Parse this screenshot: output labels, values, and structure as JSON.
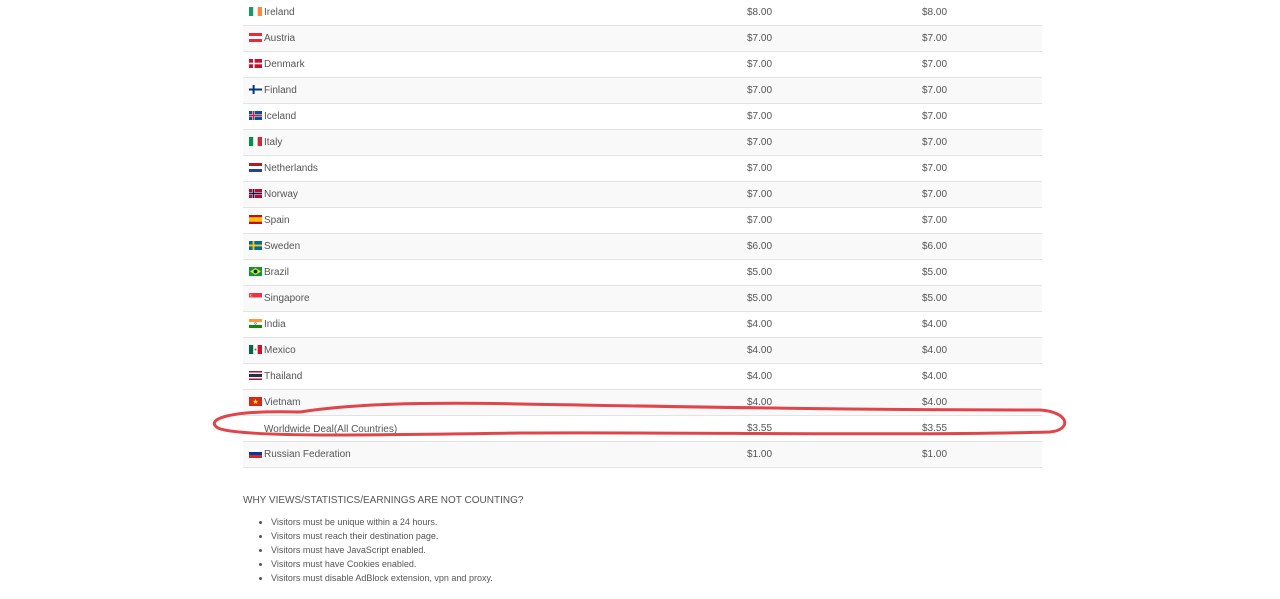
{
  "rates": [
    {
      "country": "Ireland",
      "flag": "ireland-flag-icon",
      "rate_a": "$8.00",
      "rate_b": "$8.00"
    },
    {
      "country": "Austria",
      "flag": "austria-flag-icon",
      "rate_a": "$7.00",
      "rate_b": "$7.00"
    },
    {
      "country": "Denmark",
      "flag": "denmark-flag-icon",
      "rate_a": "$7.00",
      "rate_b": "$7.00"
    },
    {
      "country": "Finland",
      "flag": "finland-flag-icon",
      "rate_a": "$7.00",
      "rate_b": "$7.00"
    },
    {
      "country": "Iceland",
      "flag": "iceland-flag-icon",
      "rate_a": "$7.00",
      "rate_b": "$7.00"
    },
    {
      "country": "Italy",
      "flag": "italy-flag-icon",
      "rate_a": "$7.00",
      "rate_b": "$7.00"
    },
    {
      "country": "Netherlands",
      "flag": "netherlands-flag-icon",
      "rate_a": "$7.00",
      "rate_b": "$7.00"
    },
    {
      "country": "Norway",
      "flag": "norway-flag-icon",
      "rate_a": "$7.00",
      "rate_b": "$7.00"
    },
    {
      "country": "Spain",
      "flag": "spain-flag-icon",
      "rate_a": "$7.00",
      "rate_b": "$7.00"
    },
    {
      "country": "Sweden",
      "flag": "sweden-flag-icon",
      "rate_a": "$6.00",
      "rate_b": "$6.00"
    },
    {
      "country": "Brazil",
      "flag": "brazil-flag-icon",
      "rate_a": "$5.00",
      "rate_b": "$5.00"
    },
    {
      "country": "Singapore",
      "flag": "singapore-flag-icon",
      "rate_a": "$5.00",
      "rate_b": "$5.00"
    },
    {
      "country": "India",
      "flag": "india-flag-icon",
      "rate_a": "$4.00",
      "rate_b": "$4.00"
    },
    {
      "country": "Mexico",
      "flag": "mexico-flag-icon",
      "rate_a": "$4.00",
      "rate_b": "$4.00"
    },
    {
      "country": "Thailand",
      "flag": "thailand-flag-icon",
      "rate_a": "$4.00",
      "rate_b": "$4.00"
    },
    {
      "country": "Vietnam",
      "flag": "vietnam-flag-icon",
      "rate_a": "$4.00",
      "rate_b": "$4.00"
    },
    {
      "country": "Worldwide Deal(All Countries)",
      "flag": "",
      "rate_a": "$3.55",
      "rate_b": "$3.55"
    },
    {
      "country": "Russian Federation",
      "flag": "russia-flag-icon",
      "rate_a": "$1.00",
      "rate_b": "$1.00"
    }
  ],
  "annotation": {
    "color": "#e0454a",
    "highlighted_row": "Worldwide Deal(All Countries)"
  },
  "info": {
    "heading": "WHY VIEWS/STATISTICS/EARNINGS ARE NOT COUNTING?",
    "items": [
      "Visitors must be unique within a 24 hours.",
      "Visitors must reach their destination page.",
      "Visitors must have JavaScript enabled.",
      "Visitors must have Cookies enabled.",
      "Visitors must disable AdBlock extension, vpn and proxy."
    ]
  }
}
